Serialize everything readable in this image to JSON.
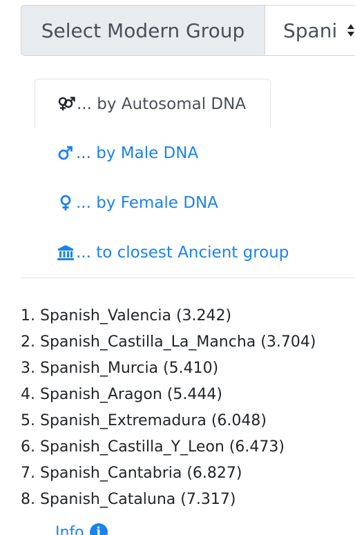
{
  "selector": {
    "label": "Select Modern Group",
    "selected_value": "Spani"
  },
  "nav": {
    "items": [
      {
        "label": "... by Autosomal DNA",
        "icon": "venus-mars-icon",
        "active": true
      },
      {
        "label": "... by Male DNA",
        "icon": "mars-icon",
        "active": false
      },
      {
        "label": "... by Female DNA",
        "icon": "venus-icon",
        "active": false
      },
      {
        "label": "... to closest Ancient group",
        "icon": "landmark-icon",
        "active": false
      }
    ]
  },
  "results": [
    "1. Spanish_Valencia (3.242)",
    "2. Spanish_Castilla_La_Mancha (3.704)",
    "3. Spanish_Murcia (5.410)",
    "4. Spanish_Aragon (5.444)",
    "5. Spanish_Extremadura (6.048)",
    "6. Spanish_Castilla_Y_Leon (6.473)",
    "7. Spanish_Cantabria (6.827)",
    "8. Spanish_Cataluna (7.317)"
  ],
  "info": {
    "label": "Info",
    "icon": "info-circle-icon"
  },
  "colors": {
    "link": "#1a82f0",
    "text": "#212529",
    "muted": "#495057",
    "addon_bg": "#e9ecef",
    "border": "#ced4da"
  }
}
